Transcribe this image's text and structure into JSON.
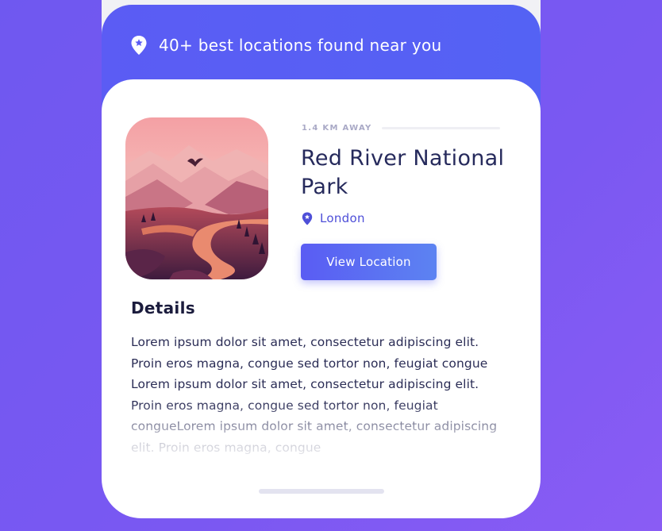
{
  "header": {
    "text": "40+ best locations found near you",
    "icon": "location-pin-icon"
  },
  "place": {
    "distance": "1.4 KM AWAY",
    "title": "Red River National Park",
    "location": "London",
    "location_icon": "location-pin-icon",
    "image": "landscape-illustration"
  },
  "actions": {
    "view_location": "View Location"
  },
  "details": {
    "heading": "Details",
    "body": "Lorem ipsum dolor sit amet, consectetur adipiscing elit. Proin eros magna, congue sed tortor non, feugiat congue Lorem ipsum dolor sit amet, consectetur adipiscing elit. Proin eros magna, congue sed tortor non, feugiat congueLorem ipsum dolor sit amet, consectetur adipiscing elit. Proin eros magna, congue"
  },
  "colors": {
    "accent": "#5b5cf4",
    "title": "#262a5c",
    "background": "#7a58f2"
  }
}
